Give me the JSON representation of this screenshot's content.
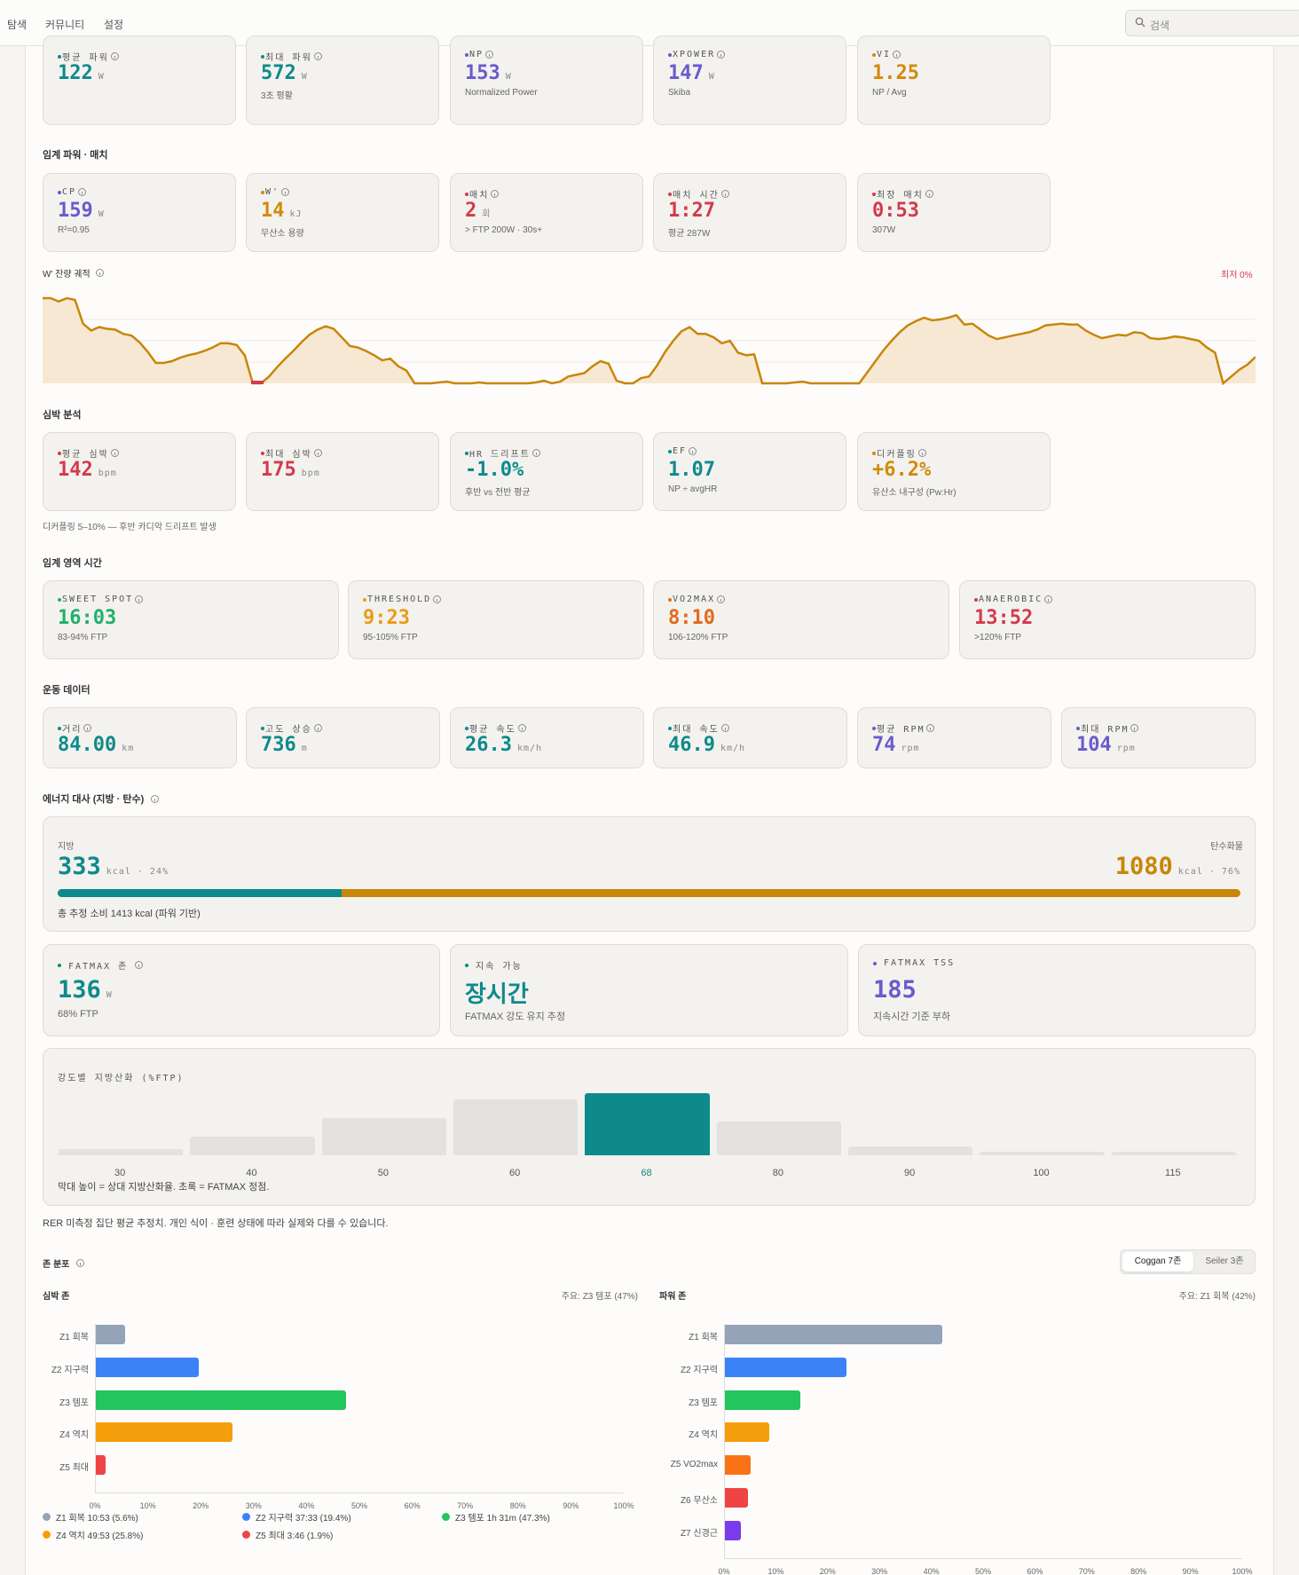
{
  "nav": {
    "items": [
      "탐색",
      "커뮤니티",
      "설정"
    ],
    "search_placeholder": "검색"
  },
  "power": {
    "cards": [
      {
        "label": "평균 파워",
        "value": "122",
        "unit": "W",
        "sub": "",
        "color": "#0e8a8a"
      },
      {
        "label": "최대 파워",
        "value": "572",
        "unit": "W",
        "sub": "3초 평활",
        "color": "#0e8a8a"
      },
      {
        "label": "NP",
        "value": "153",
        "unit": "W",
        "sub": "Normalized Power",
        "color": "#6a5acd"
      },
      {
        "label": "XPOWER",
        "value": "147",
        "unit": "W",
        "sub": "Skiba",
        "color": "#6a5acd"
      },
      {
        "label": "VI",
        "value": "1.25",
        "unit": "",
        "sub": "NP / Avg",
        "color": "#d38a0a"
      }
    ]
  },
  "critical": {
    "title": "임계 파워 · 매치",
    "cards": [
      {
        "label": "CP",
        "value": "159",
        "unit": "W",
        "sub": "R²=0.95",
        "color": "#6a5acd"
      },
      {
        "label": "W'",
        "value": "14",
        "unit": "kJ",
        "sub": "무산소 용량",
        "color": "#d38a0a"
      },
      {
        "label": "매치",
        "value": "2",
        "unit": "회",
        "sub": "> FTP 200W · 30s+",
        "color": "#d33a4b"
      },
      {
        "label": "매치 시간",
        "value": "1:27",
        "unit": "",
        "sub": "평균 287W",
        "color": "#d33a4b"
      },
      {
        "label": "최장 매치",
        "value": "0:53",
        "unit": "",
        "sub": "307W",
        "color": "#d33a4b"
      }
    ]
  },
  "wbal": {
    "title": "W' 잔량 궤적",
    "min_label": "최저 0%"
  },
  "hr": {
    "title": "심박 분석",
    "cards": [
      {
        "label": "평균 심박",
        "value": "142",
        "unit": "bpm",
        "sub": "",
        "color": "#d33a4b"
      },
      {
        "label": "최대 심박",
        "value": "175",
        "unit": "bpm",
        "sub": "",
        "color": "#d33a4b"
      },
      {
        "label": "HR 드리프트",
        "value": "-1.0%",
        "unit": "",
        "sub": "후반 vs 전반 평균",
        "color": "#0e8a8a"
      },
      {
        "label": "EF",
        "value": "1.07",
        "unit": "",
        "sub": "NP ÷ avgHR",
        "color": "#0e8a8a"
      },
      {
        "label": "디커플링",
        "value": "+6.2%",
        "unit": "",
        "sub": "유산소 내구성 (Pw:Hr)",
        "color": "#d38a0a"
      }
    ],
    "note": "디커플링 5–10% — 후반 카디악 드리프트 발생"
  },
  "zones_time": {
    "title": "임계 영역 시간",
    "cards": [
      {
        "label": "SWEET SPOT",
        "value": "16:03",
        "sub": "83-94% FTP",
        "color": "#20b06a"
      },
      {
        "label": "THRESHOLD",
        "value": "9:23",
        "sub": "95-105% FTP",
        "color": "#eb9a1a"
      },
      {
        "label": "VO2MAX",
        "value": "8:10",
        "sub": "106-120% FTP",
        "color": "#e36a1a"
      },
      {
        "label": "ANAEROBIC",
        "value": "13:52",
        "sub": ">120% FTP",
        "color": "#d33a4b"
      }
    ]
  },
  "workout": {
    "title": "운동 데이터",
    "cards": [
      {
        "label": "거리",
        "value": "84.00",
        "unit": "km",
        "color": "#0e8a8a"
      },
      {
        "label": "고도 상승",
        "value": "736",
        "unit": "m",
        "color": "#0e8a8a"
      },
      {
        "label": "평균 속도",
        "value": "26.3",
        "unit": "km/h",
        "color": "#0e8a8a"
      },
      {
        "label": "최대 속도",
        "value": "46.9",
        "unit": "km/h",
        "color": "#0e8a8a"
      },
      {
        "label": "평균 RPM",
        "value": "74",
        "unit": "rpm",
        "color": "#6a5acd"
      },
      {
        "label": "최대 RPM",
        "value": "104",
        "unit": "rpm",
        "color": "#6a5acd"
      }
    ]
  },
  "energy": {
    "title": "에너지 대사 (지방 · 탄수)",
    "fat_label": "지방",
    "fat_value": "333",
    "fat_unit": "kcal · 24%",
    "carb_label": "탄수화물",
    "carb_value": "1080",
    "carb_unit": "kcal · 76%",
    "fat_fraction": 0.24,
    "total": "총 추정 소비 1413 kcal (파워 기반)",
    "fatmax": {
      "label": "FATMAX 존",
      "value": "136",
      "unit": "W",
      "sub": "68% FTP"
    },
    "sustain": {
      "label": "지속 가능",
      "value": "장시간",
      "sub": "FATMAX 강도 유지 추정"
    },
    "tss": {
      "label": "FATMAX TSS",
      "value": "185",
      "sub": "지속시간 기준 부하"
    },
    "oxidation": {
      "title": "강도별 지방산화 (%FTP)",
      "caption": "막대 높이 = 상대 지방산화율. 초록 = FATMAX 정점."
    },
    "footnote": "RER 미측정 집단 평균 추정치. 개인 식이 · 훈련 상태에 따라 실제와 다를 수 있습니다."
  },
  "zone_dist": {
    "title": "존 분포",
    "toggle": [
      "Coggan 7존",
      "Seiler 3존"
    ],
    "hr_title": "심박 존",
    "hr_main": "주요: Z3 템포 (47%)",
    "power_title": "파워 존",
    "power_main": "주요: Z1 회복 (42%)",
    "x_ticks": [
      "0%",
      "10%",
      "20%",
      "30%",
      "40%",
      "50%",
      "60%",
      "70%",
      "80%",
      "90%",
      "100%"
    ],
    "hr_legend": [
      "Z1 회복 10:53 (5.6%)",
      "Z2 지구력 37:33 (19.4%)",
      "Z3 템포 1h 31m (47.3%)",
      "Z4 역치 49:53 (25.8%)",
      "Z5 최대 3:46 (1.9%)"
    ]
  },
  "chart_data": [
    {
      "type": "area",
      "title": "W' 잔량 궤적",
      "y_unit": "%",
      "ylim": [
        0,
        100
      ],
      "values": [
        100,
        100,
        96,
        100,
        98,
        70,
        62,
        66,
        64,
        63,
        58,
        56,
        48,
        37,
        24,
        24,
        26,
        30,
        33,
        35,
        38,
        42,
        47,
        47,
        45,
        33,
        0,
        0,
        8,
        19,
        29,
        38,
        48,
        57,
        63,
        67,
        64,
        54,
        44,
        42,
        38,
        33,
        27,
        29,
        20,
        15,
        0,
        0,
        0,
        1,
        2,
        0,
        0,
        0,
        1,
        0,
        0,
        0,
        0,
        0,
        0,
        1,
        3,
        0,
        2,
        8,
        10,
        12,
        20,
        26,
        23,
        3,
        0,
        0,
        6,
        8,
        21,
        37,
        50,
        61,
        66,
        58,
        58,
        54,
        47,
        50,
        36,
        33,
        34,
        0,
        0,
        0,
        0,
        1,
        2,
        0,
        0,
        0,
        0,
        0,
        0,
        0,
        13,
        26,
        39,
        50,
        60,
        68,
        73,
        77,
        74,
        75,
        77,
        80,
        69,
        70,
        63,
        56,
        52,
        54,
        56,
        58,
        60,
        63,
        68,
        69,
        70,
        69,
        69,
        62,
        57,
        53,
        55,
        57,
        56,
        60,
        59,
        53,
        52,
        53,
        55,
        54,
        52,
        50,
        42,
        36,
        0,
        8,
        16,
        22,
        31
      ]
    },
    {
      "type": "bar",
      "title": "강도별 지방산화 (%FTP)",
      "categories": [
        "30",
        "40",
        "50",
        "60",
        "68",
        "80",
        "90",
        "100",
        "115"
      ],
      "values": [
        10,
        30,
        60,
        90,
        100,
        55,
        15,
        3,
        2
      ],
      "highlight": "68"
    },
    {
      "type": "bar",
      "orientation": "horizontal",
      "title": "심박 존",
      "categories": [
        "Z1 회복",
        "Z2 지구력",
        "Z3 템포",
        "Z4 역치",
        "Z5 최대"
      ],
      "values": [
        5.6,
        19.4,
        47.3,
        25.8,
        1.9
      ],
      "colors": [
        "#94a3b8",
        "#3b82f6",
        "#22c55e",
        "#f59e0b",
        "#ef4444"
      ],
      "xlim": [
        0,
        100
      ]
    },
    {
      "type": "bar",
      "orientation": "horizontal",
      "title": "파워 존",
      "categories": [
        "Z1 회복",
        "Z2 지구력",
        "Z3 템포",
        "Z4 역치",
        "Z5 VO2max",
        "Z6 무산소",
        "Z7 신경근"
      ],
      "values": [
        42,
        23.5,
        14.5,
        8.5,
        5,
        4.5,
        3
      ],
      "colors": [
        "#94a3b8",
        "#3b82f6",
        "#22c55e",
        "#f59e0b",
        "#f97316",
        "#ef4444",
        "#7c3aed"
      ],
      "xlim": [
        0,
        100
      ]
    }
  ]
}
